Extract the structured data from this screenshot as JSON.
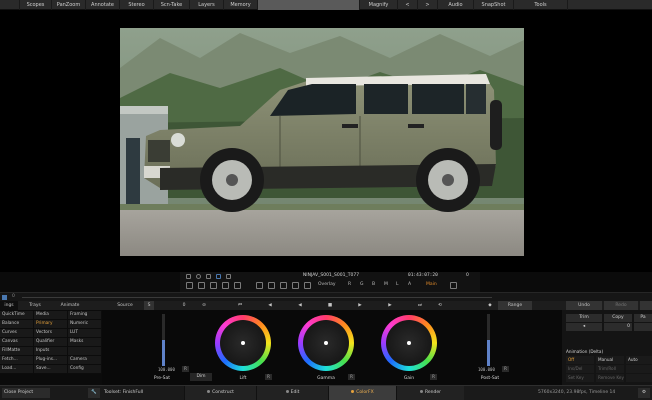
{
  "menu": [
    "Scopes",
    "PanZoom",
    "Annotate",
    "Stereo",
    "Scn-Take",
    "Layers",
    "Memory",
    "",
    "Magnify",
    "<",
    ">",
    "Audio",
    "SnapShot",
    "Tools"
  ],
  "transport": {
    "clip_name": "NINJAV_S001_S001_T077",
    "timecode": "01:43:07:20",
    "frame": "0",
    "overlay_label": "Overlay",
    "channels": [
      "R",
      "G",
      "B",
      "M",
      "L",
      "A"
    ],
    "main_label": "Main"
  },
  "scrub": {
    "value": "0"
  },
  "tabs": {
    "left": [
      "ings",
      "Trays",
      "Animate"
    ],
    "source": "Source",
    "source_btn": "S",
    "zero": "0",
    "range": "Range",
    "undo": "Undo",
    "redo": "Redo"
  },
  "menu_grid": [
    [
      "QuickTime",
      "Media",
      "Framing"
    ],
    [
      "Balance",
      "Primary",
      "Numeric"
    ],
    [
      "Curves",
      "Vectors",
      "LUT"
    ],
    [
      "Canvas",
      "Qualifier",
      "Masks"
    ],
    [
      "FillMatte",
      "Inputs",
      ""
    ],
    [
      "Fetch...",
      "Plug-ins...",
      "Camera"
    ],
    [
      "Load...",
      "Save...",
      "Config"
    ]
  ],
  "color": {
    "pre_sat_value": "100.000",
    "pre_sat_label": "Pre-Sat",
    "post_sat_value": "100.000",
    "post_sat_label": "Post-Sat",
    "wheels": [
      {
        "label": "Lift",
        "btn": "R"
      },
      {
        "label": "Gamma",
        "btn": "R"
      },
      {
        "label": "Gain",
        "btn": "R"
      }
    ],
    "dim_label": "Dim",
    "r_label": "R",
    "pre_sat_level": 0.5,
    "post_sat_level": 0.5
  },
  "right": {
    "trim": "Trim",
    "copy": "Copy",
    "paste": "Pa",
    "value": "0",
    "anim_title": "Animation (Delta)",
    "anim_cells": [
      "Off",
      "Manual",
      "Auto",
      "Ins/Del",
      "Trim/Roll",
      "",
      "Set Key",
      "Remove Key",
      ""
    ]
  },
  "bottom": {
    "close_project": "Close Project",
    "toolset": "Toolset: FinishFull",
    "tabs": [
      "Construct",
      "Edit",
      "ColorFX",
      "Render"
    ],
    "info": "5760x3240, 23.98fps, Timeline 14",
    "settings_icon": "gear-icon"
  },
  "accent": "#e6a23c"
}
